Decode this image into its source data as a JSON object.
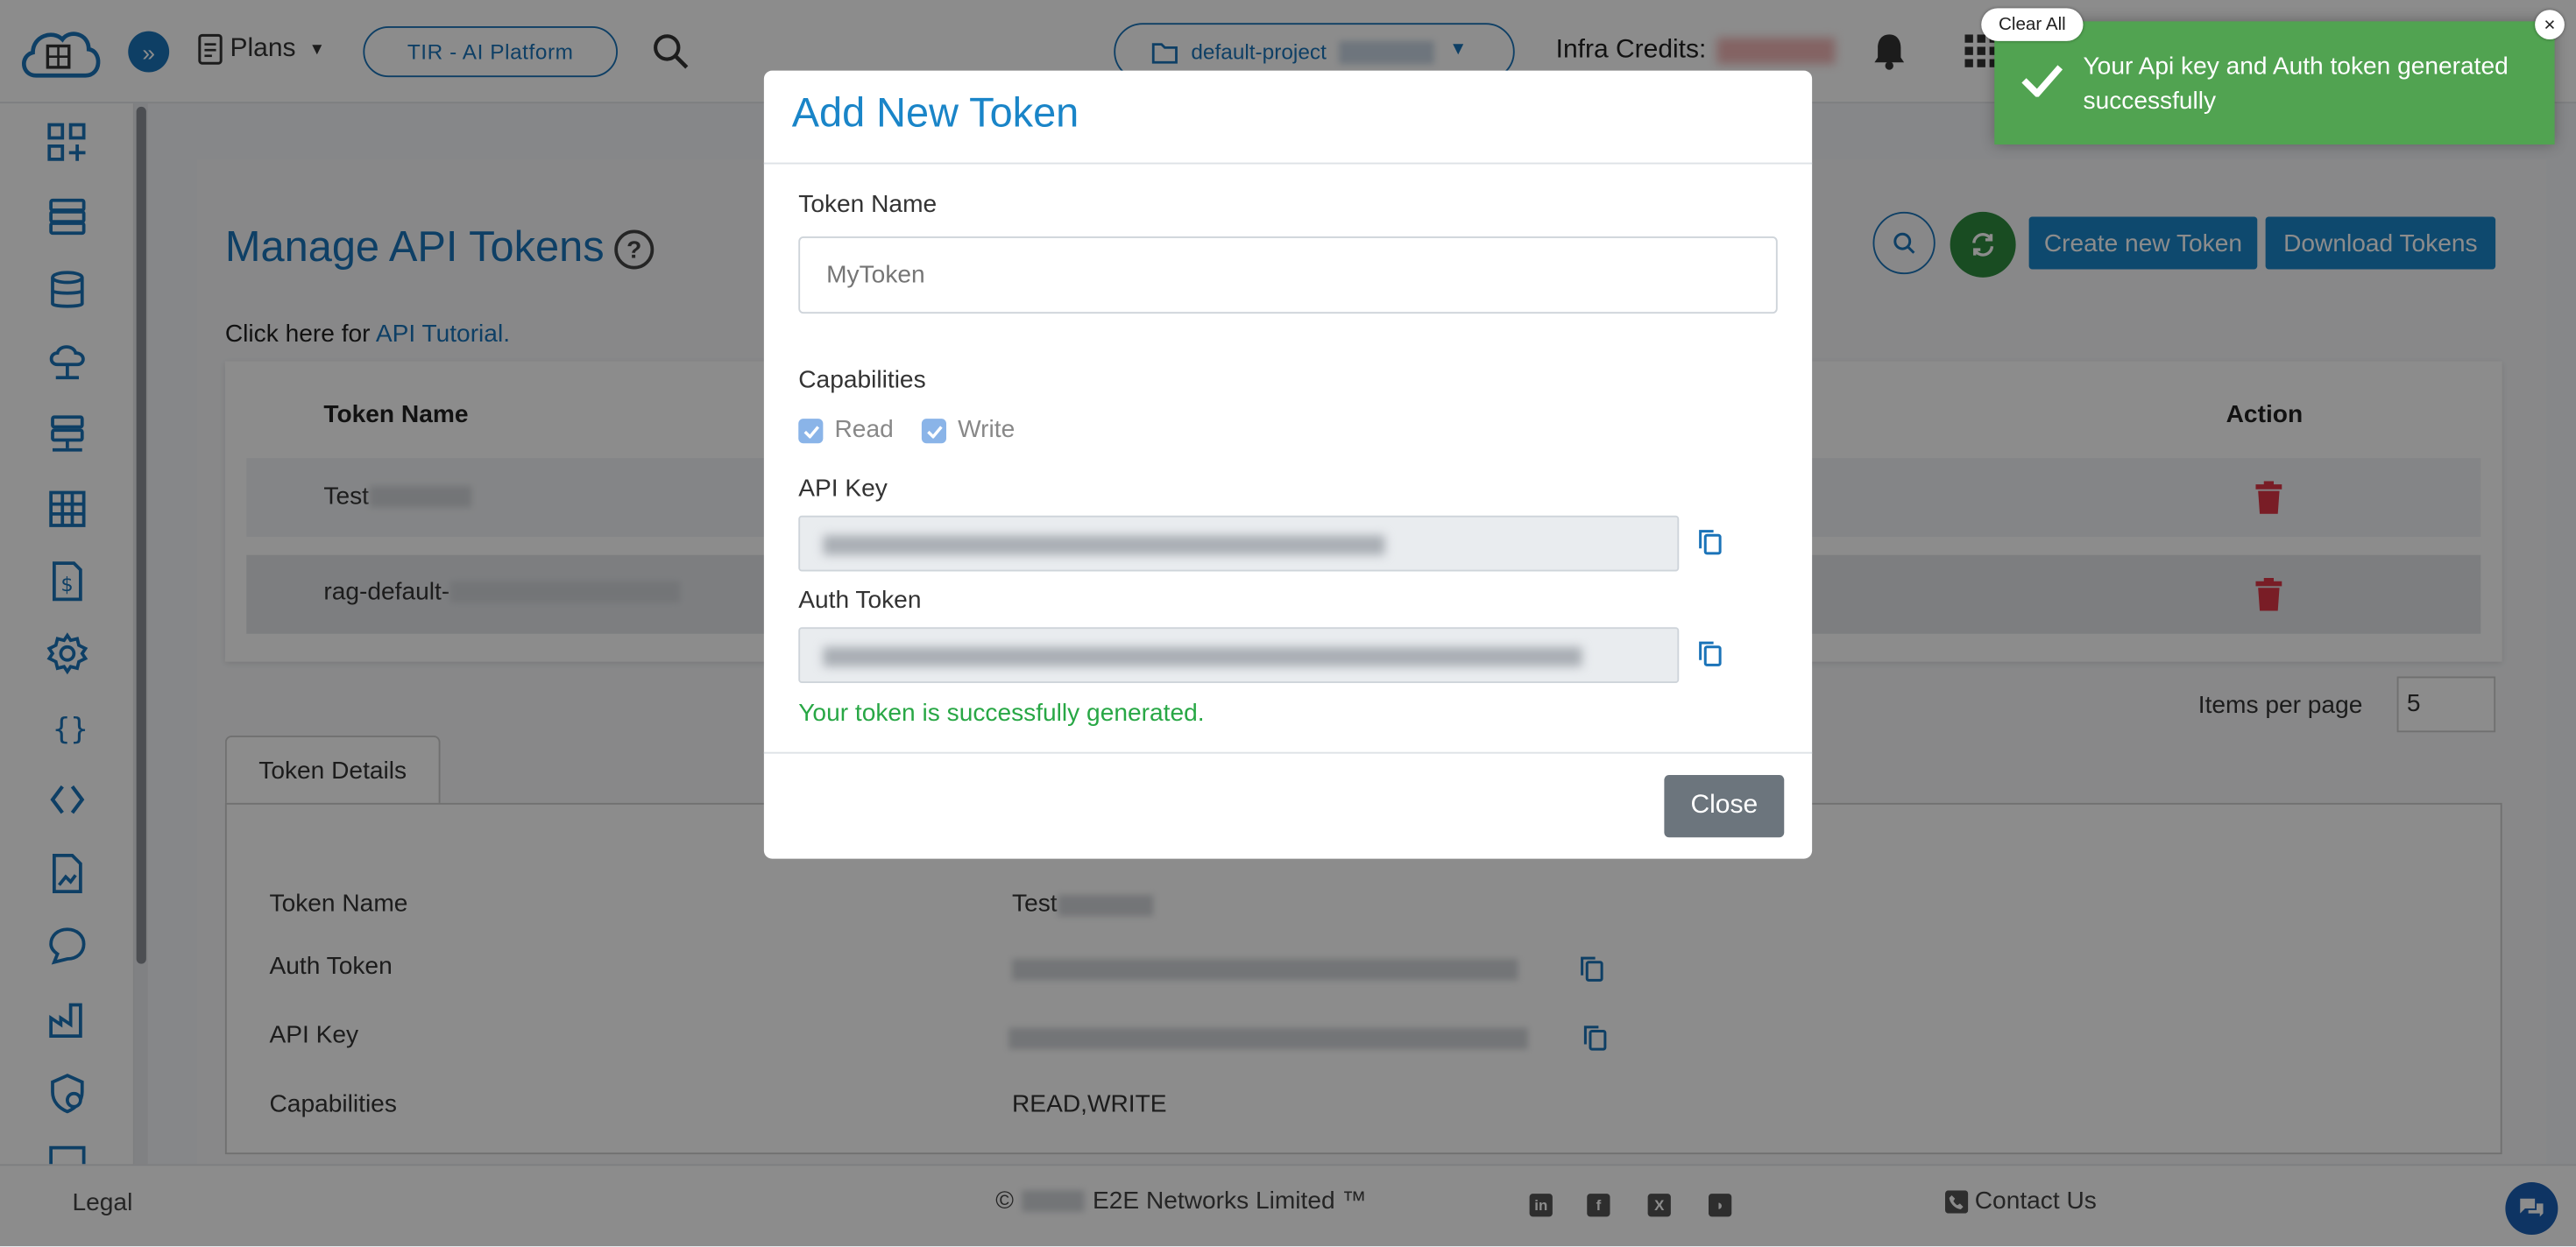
{
  "topbar": {
    "plans_label": "Plans",
    "platform_label": "TIR - AI Platform",
    "project_label": "default-project",
    "infra_label": "Infra Credits:"
  },
  "page": {
    "title": "Manage API Tokens",
    "tutorial_prefix": "Click here for ",
    "tutorial_link": "API Tutorial.",
    "create_btn": "Create new Token",
    "download_btn": "Download Tokens",
    "columns": {
      "name": "Token Name",
      "action": "Action"
    },
    "rows": [
      {
        "name": "Test"
      },
      {
        "name": "rag-default-"
      }
    ],
    "items_per_page_label": "Items per page",
    "items_per_page_value": "5",
    "tab_label": "Token Details",
    "details": {
      "token_name_label": "Token Name",
      "token_name_value": "Test",
      "auth_token_label": "Auth Token",
      "api_key_label": "API Key",
      "capabilities_label": "Capabilities",
      "capabilities_value": "READ,WRITE"
    }
  },
  "modal": {
    "title": "Add New Token",
    "token_name_label": "Token Name",
    "token_name_placeholder": "MyToken",
    "capabilities_label": "Capabilities",
    "read_label": "Read",
    "write_label": "Write",
    "api_key_label": "API Key",
    "auth_token_label": "Auth Token",
    "success": "Your token is successfully generated.",
    "close_btn": "Close"
  },
  "toast": {
    "message": "Your Api key and Auth token generated successfully",
    "clear_all": "Clear All",
    "close": "×"
  },
  "footer": {
    "legal": "Legal",
    "copyright_symbol": "©",
    "company": "E2E Networks Limited ™",
    "contact": "Contact Us"
  },
  "colors": {
    "primary": "#1a85c8",
    "success_toast": "#51a351",
    "success_text": "#28a745",
    "danger": "#dc3545"
  }
}
